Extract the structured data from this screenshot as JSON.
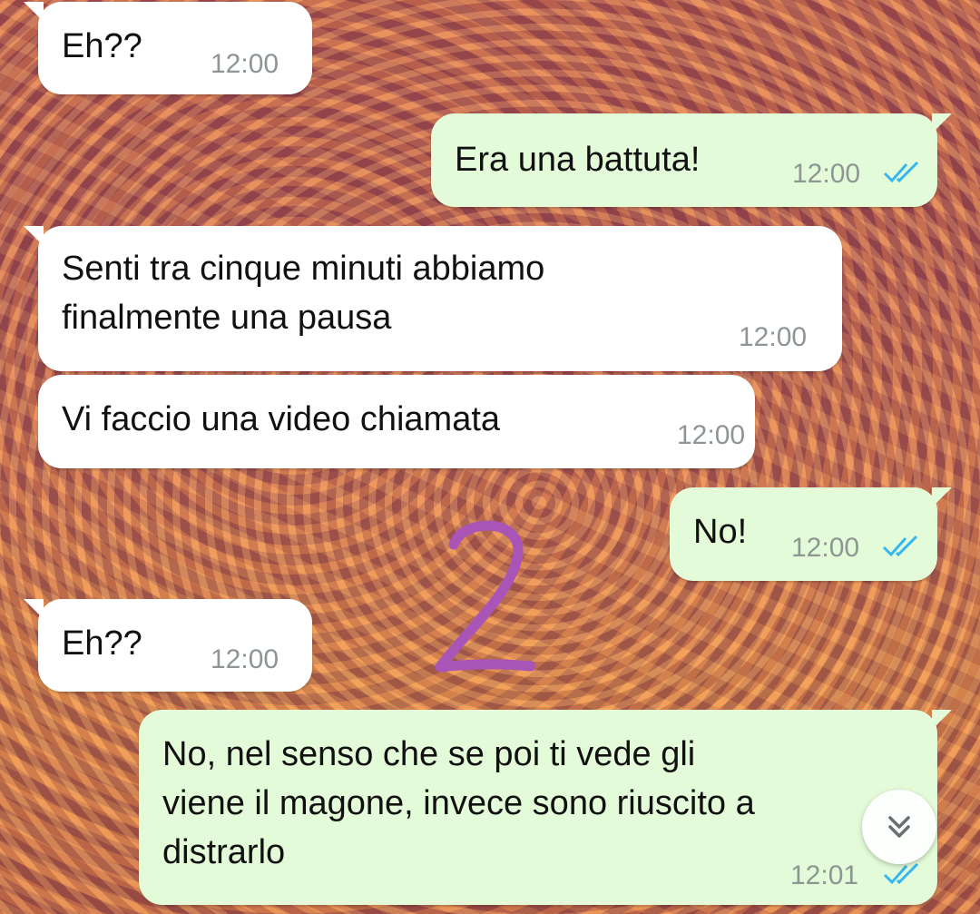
{
  "messages": [
    {
      "side": "in",
      "text": "Eh??",
      "time": "12:00"
    },
    {
      "side": "out",
      "text": "Era una battuta!",
      "time": "12:00",
      "status": "read"
    },
    {
      "side": "in",
      "text": "Senti tra cinque minuti abbiamo\nfinalmente una pausa",
      "time": "12:00"
    },
    {
      "side": "in",
      "text": "Vi faccio una video chiamata",
      "time": "12:00"
    },
    {
      "side": "out",
      "text": "No!",
      "time": "12:00",
      "status": "read"
    },
    {
      "side": "in",
      "text": "Eh??",
      "time": "12:00"
    },
    {
      "side": "out",
      "text": "No, nel senso che se poi ti vede gli\nviene il magone, invece sono riuscito a\ndistrarlo",
      "time": "12:01",
      "status": "read"
    }
  ],
  "annotation": {
    "text": "2",
    "color": "#a855b7"
  },
  "icons": {
    "read_ticks": "double-check-icon",
    "scroll_down": "double-chevron-down-icon"
  },
  "colors": {
    "incoming": "#ffffff",
    "outgoing": "#e4fbd9",
    "tick": "#34b7f1",
    "time": "#8e9693"
  }
}
